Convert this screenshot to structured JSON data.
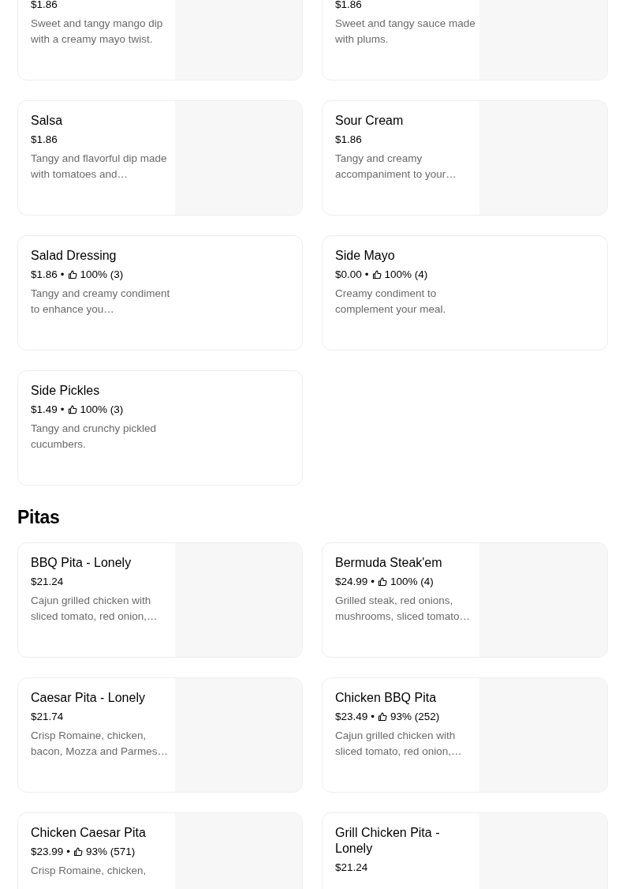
{
  "sections": [
    {
      "items": [
        {
          "price": "$1.86",
          "description": "Sweet and tangy mango dip with a creamy mayo twist.",
          "has_image": true
        },
        {
          "price": "$1.86",
          "description": "Sweet and tangy sauce made with plums.",
          "has_image": true
        },
        {
          "name": "Salsa",
          "price": "$1.86",
          "description": "Tangy and flavorful dip made with tomatoes and…",
          "has_image": true
        },
        {
          "name": "Sour Cream",
          "price": "$1.86",
          "description": "Tangy and creamy accompaniment to your…",
          "has_image": true
        },
        {
          "name": "Salad Dressing",
          "price": "$1.86",
          "separator": "•",
          "rating": "100% (3)",
          "description": "Tangy and creamy condiment to enhance you…",
          "has_image": false
        },
        {
          "name": "Side Mayo",
          "price": "$0.00",
          "separator": "•",
          "rating": "100% (4)",
          "description": "Creamy condiment to complement your meal.",
          "has_image": false
        },
        {
          "name": "Side Pickles",
          "price": "$1.49",
          "separator": "•",
          "rating": "100% (3)",
          "description": "Tangy and crunchy pickled cucumbers.",
          "has_image": false
        }
      ]
    },
    {
      "title": "Pitas",
      "items": [
        {
          "name": "BBQ Pita - Lonely",
          "price": "$21.24",
          "description": "Cajun grilled chicken with sliced tomato, red onion,…",
          "has_image": true
        },
        {
          "name": "Bermuda Steak'em",
          "price": "$24.99",
          "separator": "•",
          "rating": "100% (4)",
          "description": "Grilled steak, red onions, mushrooms, sliced tomato…",
          "has_image": true
        },
        {
          "name": "Caesar Pita - Lonely",
          "price": "$21.74",
          "description": "Crisp Romaine, chicken, bacon, Mozza and Parmes…",
          "has_image": true
        },
        {
          "name": "Chicken BBQ Pita",
          "price": "$23.49",
          "separator": "•",
          "rating": "93% (252)",
          "description": "Cajun grilled chicken with sliced tomato, red onion,…",
          "has_image": true
        },
        {
          "name": "Chicken Caesar Pita",
          "price": "$23.99",
          "separator": "•",
          "rating": "93% (571)",
          "description": "Crisp Romaine, chicken,",
          "has_image": true
        },
        {
          "name": "Grill Chicken Pita - Lonely",
          "price": "$21.24",
          "has_image": true
        }
      ]
    }
  ]
}
